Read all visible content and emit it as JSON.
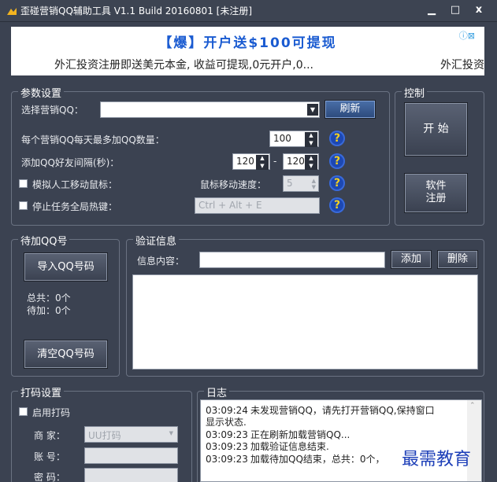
{
  "window": {
    "title": "歪碰营销QQ辅助工具 V1.1 Build 20160801    [未注册]",
    "minimize": "▁",
    "maximize": "□",
    "close": "x"
  },
  "ad": {
    "line1": "【爆】开户送$100可提现",
    "line2": "外汇投资注册即送美元本金, 收益可提现,0元开户,0...",
    "line2_tail": "外汇投资",
    "close": "ⓘ⊠"
  },
  "params": {
    "title": "参数设置",
    "select_qq_label": "选择营销QQ：",
    "select_qq_value": "",
    "refresh_label": "刷新",
    "max_add_label": "每个营销QQ每天最多加QQ数量：",
    "max_add_value": "100",
    "interval_label": "添加QQ好友间隔(秒)：",
    "interval_min": "120",
    "interval_sep": "-",
    "interval_max": "120",
    "simulate_mouse_label": "模拟人工移动鼠标：",
    "mouse_speed_label": "鼠标移动速度：",
    "mouse_speed_value": "5",
    "stop_hotkey_label": "停止任务全局热键：",
    "hotkey_value": "Ctrl + Alt + E",
    "help": "?"
  },
  "control": {
    "title": "控制",
    "start_label": "开 始",
    "register_label_1": "软件",
    "register_label_2": "注册"
  },
  "pending": {
    "title": "待加QQ号",
    "import_label": "导入QQ号码",
    "total": "总共：0个",
    "waiting": "待加：0个",
    "clear_label": "清空QQ号码"
  },
  "verify": {
    "title": "验证信息",
    "content_label": "信息内容：",
    "content_value": "",
    "add_label": "添加",
    "delete_label": "删除"
  },
  "captcha": {
    "title": "打码设置",
    "enable_label": "启用打码",
    "vendor_label": "商  家：",
    "vendor_value": "UU打码",
    "account_label": "账  号：",
    "password_label": "密  码："
  },
  "log": {
    "title": "日志",
    "entries": [
      {
        "time": "03:09:24",
        "msg": "未发现营销QQ，请先打开营销QQ,保持窗口"
      },
      {
        "time": "",
        "msg": "显示状态."
      },
      {
        "time": "03:09:23",
        "msg": "正在刷新加载营销QQ..."
      },
      {
        "time": "03:09:23",
        "msg": "加载验证信息结束."
      },
      {
        "time": "03:09:23",
        "msg": "加载待加QQ结束，总共：0个，"
      }
    ]
  },
  "watermark": "最需教育"
}
